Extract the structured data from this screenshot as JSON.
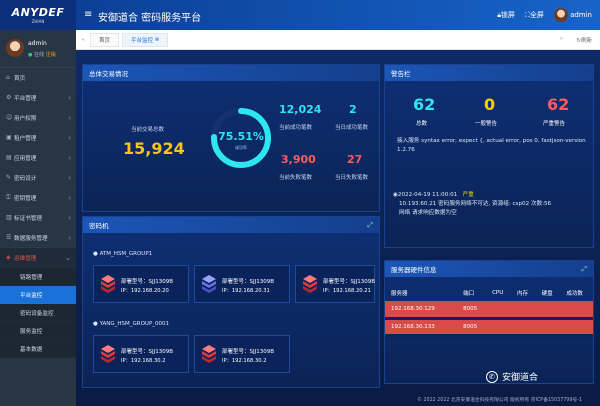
{
  "brand": {
    "logo": "ANYDEF",
    "logo_sub": "ZHIAN"
  },
  "header": {
    "title": "安御道合 密码服务平台",
    "lock": "锁屏",
    "fullscreen": "全屏",
    "user": "admin"
  },
  "sidebar": {
    "user": {
      "name": "admin",
      "online": "在线",
      "logout": "注销"
    },
    "items": [
      {
        "label": "首页"
      },
      {
        "label": "平台管理"
      },
      {
        "label": "用户权限"
      },
      {
        "label": "租户管理"
      },
      {
        "label": "应用管理"
      },
      {
        "label": "密码设计"
      },
      {
        "label": "密钥管理"
      },
      {
        "label": "标证书管理"
      },
      {
        "label": "数据服务管理"
      },
      {
        "label": "运维管理"
      }
    ],
    "subitems": [
      {
        "label": "链路管理"
      },
      {
        "label": "平台监控"
      },
      {
        "label": "密码设备监控"
      },
      {
        "label": "服务监控"
      },
      {
        "label": "基本数据"
      }
    ]
  },
  "tabs": {
    "home": "首页",
    "current": "平台监控",
    "refresh": "刷新"
  },
  "overview": {
    "title": "总体交易情况",
    "today_label": "当前交易总数",
    "today_value": "15,924",
    "rate": "75.51%",
    "rate_label": "成功率",
    "rate_fraction": 0.7551,
    "success_total": "12,024",
    "success_total_label": "当前成功笔数",
    "success_today": "2",
    "success_today_label": "当日成功笔数",
    "fail_total": "3,900",
    "fail_total_label": "当前失败笔数",
    "fail_today": "27",
    "fail_today_label": "当日失败笔数"
  },
  "crypto": {
    "title": "密码机",
    "groups": [
      {
        "name": "ATM_HSM_GROUP1",
        "devices": [
          {
            "model": "部署型号：SJJ1309B",
            "ip": "IP：192.168.20.20",
            "color": "#e23b3b"
          },
          {
            "model": "部署型号：SJJ1309B",
            "ip": "IP：192.168.20.31",
            "color": "#6b6fe8"
          },
          {
            "model": "部署型号：SJJ1309B",
            "ip": "IP：192.168.20.21",
            "color": "#e23b3b"
          }
        ]
      },
      {
        "name": "YANG_HSM_GROUP_0001",
        "devices": [
          {
            "model": "部署型号：SJJ1309B",
            "ip": "IP：192.168.30.2",
            "color": "#e23b3b"
          },
          {
            "model": "部署型号：SJJ1309B",
            "ip": "IP：192.168.30.2",
            "color": "#e23b3b"
          }
        ]
      }
    ]
  },
  "alerts": {
    "title": "警告栏",
    "total": "62",
    "total_label": "总数",
    "normal": "0",
    "normal_label": "一般警告",
    "severe": "62",
    "severe_label": "严重警告",
    "log1": "接入服务        syntax error, expect {, actual error, pos 0, fastjson-version 1.2.76",
    "log2_time": "2022-04-19 11:00:01",
    "log2_level": "严重",
    "log2_body": "10.193.60.21    密码服务网络不可达, 资源组:  csp02    次数:56",
    "log2_body2": "网络    请求响应数据为空"
  },
  "hardware": {
    "title": "服务器硬件信息",
    "columns": [
      "服务器",
      "端口",
      "CPU",
      "内存",
      "硬盘",
      "成功数"
    ],
    "rows": [
      [
        "192.168.30.129",
        "8005",
        "",
        "",
        "",
        ""
      ],
      [
        "192.168.30.133",
        "8005",
        "",
        "",
        "",
        ""
      ]
    ]
  },
  "footer": "© 2022 2022 北京安御道合科技有限公司 版权所有 京ICP备15037799号-1",
  "watermark": "安御道合"
}
